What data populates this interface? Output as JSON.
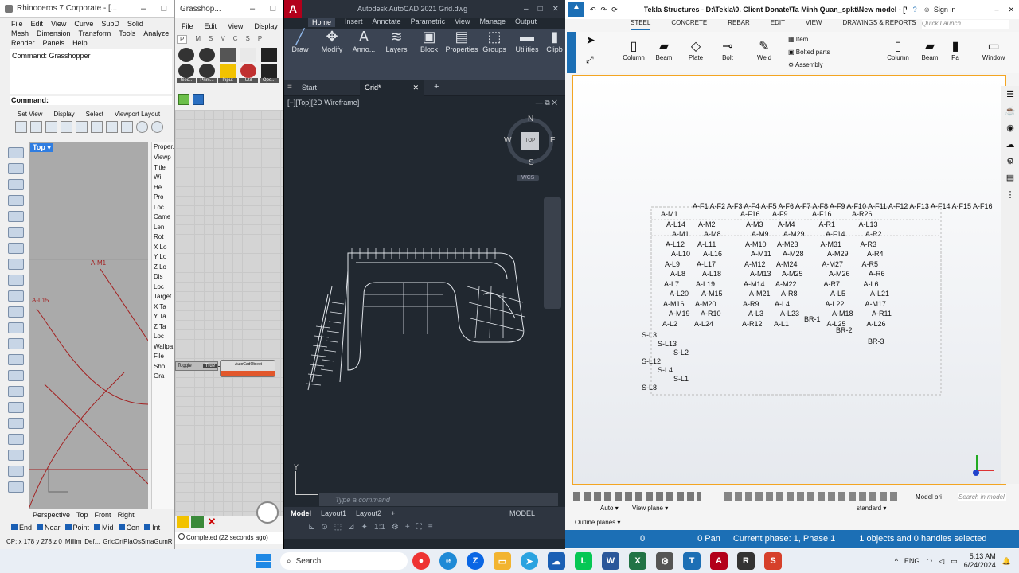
{
  "rhino": {
    "title": "Rhinoceros 7 Corporate - [...",
    "menu1": [
      "File",
      "Edit",
      "View",
      "Curve",
      "SubD",
      "Solid"
    ],
    "menu2": [
      "Mesh",
      "Dimension",
      "Transform",
      "Tools",
      "Analyze"
    ],
    "menu3": [
      "Render",
      "Panels",
      "Help"
    ],
    "command_history": "Command: Grasshopper",
    "command_label": "Command:",
    "tabs": [
      "Set View",
      "Display",
      "Select",
      "Viewport Layout"
    ],
    "viewport_name": "Top",
    "curve_labels": [
      "A-M1",
      "A-L15"
    ],
    "view_tabs": [
      "Perspective",
      "Top",
      "Front",
      "Right"
    ],
    "osnaps": [
      "End",
      "Near",
      "Point",
      "Mid",
      "Cen",
      "Int"
    ],
    "coords": "CP: x 178 y 278 z 0",
    "status_items": [
      "Millim",
      "Def...",
      "GricOrtPlaOsSmaGumR"
    ],
    "props_title": "Proper...",
    "props_labels": [
      "Viewp",
      "Title",
      "Wi",
      "He",
      "Pro",
      "Loc",
      "Came",
      "Len",
      "Rot",
      "X Lo",
      "Y Lo",
      "Z Lo",
      "Dis",
      "Loc",
      "Target",
      "X Ta",
      "Y Ta",
      "Z Ta",
      "Loc",
      "Wallpa",
      "File",
      "Sho",
      "Gra"
    ]
  },
  "grasshopper": {
    "title": "Grasshop...",
    "menu": [
      "File",
      "Edit",
      "View",
      "Display"
    ],
    "tabs": [
      "P",
      "M",
      "S",
      "V",
      "C",
      "S",
      "P"
    ],
    "groups": [
      "Geo..",
      "Prim...",
      "Input",
      "Util",
      "Ope..."
    ],
    "toggle_label": "Toggle",
    "toggle_value": "True",
    "component_label": "AutoCadObject",
    "status": "Completed (22 seconds ago)"
  },
  "autocad": {
    "title": "Autodesk AutoCAD 2021   Grid.dwg",
    "ribbon_tabs": [
      "Home",
      "Insert",
      "Annotate",
      "Parametric",
      "View",
      "Manage",
      "Output"
    ],
    "ribbon_buttons": [
      "Draw",
      "Modify",
      "Anno...",
      "Layers",
      "Block",
      "Properties",
      "Groups",
      "Utilities",
      "Clipb"
    ],
    "file_tabs": [
      "Start",
      "Grid*"
    ],
    "viewport_label": "[−][Top][2D Wireframe]",
    "compass": {
      "n": "N",
      "s": "S",
      "e": "E",
      "w": "W",
      "top": "TOP",
      "wcs": "WCS"
    },
    "command_placeholder": "Type a command",
    "layout_tabs": [
      "Model",
      "Layout1",
      "Layout2"
    ],
    "model_label": "MODEL"
  },
  "tekla": {
    "title": "Tekla Structures - D:\\Tekla\\0. Client Donate\\Ta Minh Quan_spkt\\New model - [View 1 - 3d]",
    "sign_in": "Sign in",
    "tabs": [
      "STEEL",
      "CONCRETE",
      "REBAR",
      "EDIT",
      "VIEW",
      "DRAWINGS & REPORTS",
      "M"
    ],
    "quick_launch": "Quick Launch",
    "tools": [
      "Column",
      "Beam",
      "Plate",
      "Bolt",
      "Weld"
    ],
    "item_buttons": [
      "Item",
      "Bolted parts",
      "Assembly"
    ],
    "tools_right": [
      "Column",
      "Beam",
      "Pa",
      "Window"
    ],
    "bottom": {
      "auto": "Auto",
      "view_plane": "View plane",
      "standard": "standard",
      "model_ori": "Model ori",
      "outline_planes": "Outline planes",
      "search": "Search in model"
    },
    "status_zero": "0",
    "status_pan": "0 Pan",
    "status_phase": "Current phase: 1, Phase 1",
    "status_selected": "1 objects and 0 handles selected",
    "labels_a": [
      "A-M1",
      "A-F1 A-F2 A-F3 A-F4 A-F5 A-F6 A-F7 A-F8 A-F9 A-F10 A-F11 A-F12 A-F13 A-F14 A-F15 A-F16",
      "A-F16",
      "A-F9",
      "A-F16",
      "A-R26",
      "A-L14",
      "A-M2",
      "A-M3",
      "A-M4",
      "A-R1",
      "A-L13",
      "A-M1",
      "A-M8",
      "A-M9",
      "A-M29",
      "A-F14",
      "A-R2",
      "A-L12",
      "A-L11",
      "A-M10",
      "A-M23",
      "A-M31",
      "A-R3",
      "A-L10",
      "A-L16",
      "A-M11",
      "A-M28",
      "A-M29",
      "A-R4",
      "A-L9",
      "A-L17",
      "A-M12",
      "A-M24",
      "A-M27",
      "A-R5",
      "A-L8",
      "A-L18",
      "A-M13",
      "A-M25",
      "A-M26",
      "A-R6",
      "A-L7",
      "A-L19",
      "A-M14",
      "A-M22",
      "A-R7",
      "A-L6",
      "A-L20",
      "A-M15",
      "A-M21",
      "A-R8",
      "A-L5",
      "A-L21",
      "A-M16",
      "A-M20",
      "A-R9",
      "A-L4",
      "A-L22",
      "A-M17",
      "A-M19",
      "A-R10",
      "A-L3",
      "A-L23",
      "A-M18",
      "A-R11",
      "A-L2",
      "A-L24",
      "A-R12",
      "A-L1",
      "A-L25",
      "A-L26"
    ],
    "labels_s": [
      "S-L3",
      "S-L13",
      "S-L2",
      "S-L12",
      "S-L4",
      "S-L1",
      "S-L8",
      "BR-1",
      "BR-2",
      "BR-3"
    ],
    "axis": {
      "x": "x",
      "y": "y",
      "z": "z"
    }
  },
  "taskbar": {
    "search": "Search",
    "lang": "ENG",
    "time": "5:13 AM",
    "date": "6/24/2024"
  }
}
